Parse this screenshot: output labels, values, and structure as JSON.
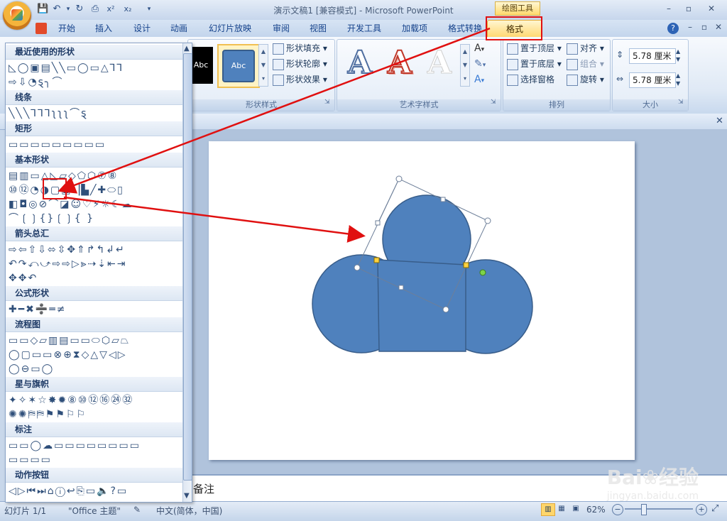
{
  "window": {
    "title": "演示文稿1 [兼容模式] - Microsoft PowerPoint",
    "context_tool": "绘图工具",
    "controls": {
      "minimize": "–",
      "maximize": "▫",
      "close": "✕"
    }
  },
  "quick_access": {
    "save": "💾",
    "undo": "↶",
    "redo": "↻",
    "print": "⎙",
    "superscript": "x²",
    "subscript": "x₂",
    "more": "▾"
  },
  "tabs": [
    {
      "label": "开始"
    },
    {
      "label": "插入"
    },
    {
      "label": "设计"
    },
    {
      "label": "动画"
    },
    {
      "label": "幻灯片放映"
    },
    {
      "label": "审阅"
    },
    {
      "label": "视图"
    },
    {
      "label": "开发工具"
    },
    {
      "label": "加载项"
    },
    {
      "label": "格式转换"
    },
    {
      "label": "格式"
    }
  ],
  "ribbon": {
    "shape_styles": {
      "label": "形状样式",
      "preview_black": "Abc",
      "preview_blue": "Abc",
      "fill": "形状填充",
      "outline": "形状轮廓",
      "effect": "形状效果"
    },
    "wordart": {
      "label": "艺术字样式",
      "glyph": "A"
    },
    "arrange": {
      "label": "排列",
      "bring_front": "置于顶层",
      "send_back": "置于底层",
      "selection_pane": "选择窗格",
      "align": "对齐",
      "group": "组合",
      "rotate": "旋转"
    },
    "size": {
      "label": "大小",
      "height": "5.78 厘米",
      "width": "5.78 厘米"
    }
  },
  "gallery": {
    "categories": [
      "最近使用的形状",
      "线条",
      "矩形",
      "基本形状",
      "箭头总汇",
      "公式形状",
      "流程图",
      "星与旗帜",
      "标注",
      "动作按钮"
    ],
    "rows": {
      "recent": [
        "◺◯▣▤╲╲▭◯▭△⅂⅂",
        "⇨⇩◔ȿ╮⌒"
      ],
      "lines": [
        "╲╲╲⅂⅂⅂ʅʅʅ⌒ȿ"
      ],
      "rect": [
        "▭▭▭▭▭▭▭▭▭"
      ],
      "basic": [
        "▤▥▭△◺▱◇⬠⬡⑦⑧",
        "⑩⑫◔◑▢▣▕▙╱✚⬭▯",
        "◧◘◎⊘⌒◪☺♡⚡☼☾☁",
        "⌒❲❳{}❲❳{ }"
      ],
      "arrows": [
        "⇨⇦⇧⇩⬄⇳✥⇑↱↰↲↵",
        "↶↷⤺⤻⇨⇨▷⪢⇢⇣⇤⇥",
        "✥✥↶"
      ],
      "equation": [
        "✚━✖➗═≠"
      ],
      "flow": [
        "▭▭◇▱▥▤▭▭⬭⬡▱⏢",
        "◯▢▭▭⊗⊕⧗◇△▽◁▷",
        "◯⊖▭◯"
      ],
      "stars": [
        "✦✧✶☆✸✹⑧⑩⑫⑯㉔㉜",
        "✺✺⛿⛿⚑⚑⚐⚐"
      ],
      "callouts": [
        "▭▭◯☁▭▭▭▭▭▭▭▭",
        "▭▭▭▭"
      ],
      "actions": [
        "◁▷⏮⏭⌂ⓘ↩⎘▭🔈?▭"
      ]
    }
  },
  "notes_placeholder": "备注",
  "status": {
    "slide": "幻灯片 1/1",
    "theme": "\"Office 主题\"",
    "language": "中文(简体，中国)",
    "zoom": "62%"
  },
  "watermark": {
    "brand": "Bai❀经验",
    "url": "jingyan.baidu.com"
  },
  "colors": {
    "shape_fill": "#4f81bd",
    "shape_stroke": "#385d8a",
    "annotation": "#e01010",
    "highlight": "#ffd66b"
  }
}
